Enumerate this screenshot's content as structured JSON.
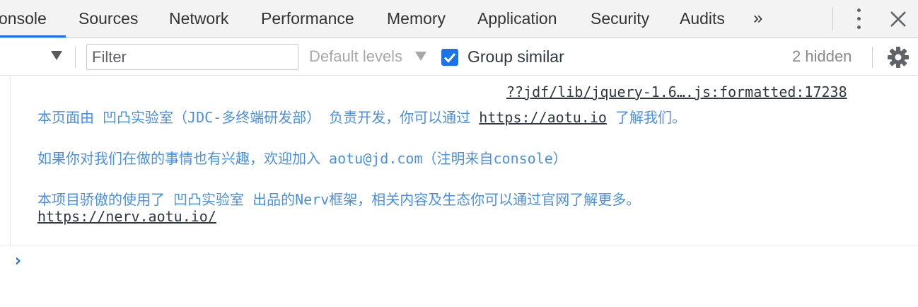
{
  "tabs": [
    {
      "label": "onsole",
      "active": true
    },
    {
      "label": "Sources"
    },
    {
      "label": "Network"
    },
    {
      "label": "Performance"
    },
    {
      "label": "Memory"
    },
    {
      "label": "Application"
    },
    {
      "label": "Security"
    },
    {
      "label": "Audits"
    }
  ],
  "tabbar": {
    "more_label": "»"
  },
  "toolbar": {
    "filter_placeholder": "Filter",
    "levels_label": "Default levels",
    "group_similar_label": "Group similar",
    "group_similar_checked": true,
    "hidden_count": "2 hidden"
  },
  "console": {
    "source_link": "??jdf/lib/jquery-1.6….js:formatted:17238",
    "lines": [
      {
        "text": "本页面由 凹凸实验室（JDC-多终端研发部） 负责开发，你可以通过 ",
        "link": "https://aotu.io",
        "suffix": " 了解我们。"
      },
      {
        "text": "如果你对我们在做的事情也有兴趣，欢迎加入 aotu@jd.com（注明来自console）"
      },
      {
        "text": "本项目骄傲的使用了 凹凸实验室 出品的Nerv框架，相关内容及生态你可以通过官网了解更多。"
      },
      {
        "link": "https://nerv.aotu.io/"
      }
    ],
    "prompt": "›"
  },
  "colors": {
    "accent": "#1a73e8",
    "message_text": "#4a90e2",
    "tab_bg": "#f3f3f3"
  }
}
